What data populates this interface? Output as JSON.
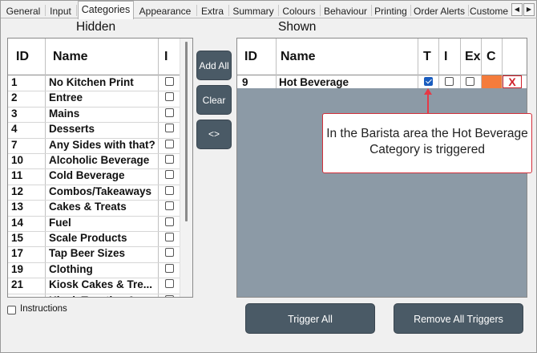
{
  "tabs": [
    "General",
    "Input",
    "Categories",
    "Appearance",
    "Extra",
    "Summary",
    "Colours",
    "Behaviour",
    "Printing",
    "Order Alerts",
    "Custome"
  ],
  "active_tab": "Categories",
  "tab_arrows": {
    "left": "◀",
    "right": "▶"
  },
  "hidden": {
    "title": "Hidden",
    "columns": {
      "id": "ID",
      "name": "Name",
      "i": "I"
    },
    "rows": [
      {
        "id": "1",
        "name": "No Kitchen Print"
      },
      {
        "id": "2",
        "name": "Entree"
      },
      {
        "id": "3",
        "name": "Mains"
      },
      {
        "id": "4",
        "name": "Desserts"
      },
      {
        "id": "7",
        "name": "Any Sides with that?"
      },
      {
        "id": "10",
        "name": "Alcoholic Beverage"
      },
      {
        "id": "11",
        "name": "Cold Beverage"
      },
      {
        "id": "12",
        "name": "Combos/Takeaways"
      },
      {
        "id": "13",
        "name": "Cakes & Treats"
      },
      {
        "id": "14",
        "name": "Fuel"
      },
      {
        "id": "15",
        "name": "Scale Products"
      },
      {
        "id": "17",
        "name": "Tap Beer Sizes"
      },
      {
        "id": "19",
        "name": "Clothing"
      },
      {
        "id": "21",
        "name": "Kiosk Cakes & Tre..."
      },
      {
        "id": "",
        "name": "Kiosk Toasties &..."
      }
    ]
  },
  "buttons": {
    "add_all": "Add All",
    "clear": "Clear",
    "swap": "<>",
    "trigger_all": "Trigger All",
    "remove_all_triggers": "Remove All Triggers"
  },
  "shown": {
    "title": "Shown",
    "columns": {
      "id": "ID",
      "name": "Name",
      "t": "T",
      "i": "I",
      "ex": "Ex",
      "c": "C"
    },
    "rows": [
      {
        "id": "9",
        "name": "Hot Beverage",
        "t": true,
        "i": false,
        "ex": false,
        "color": "#f47c3c",
        "remove": "X"
      }
    ]
  },
  "instructions_label": "Instructions",
  "callout": "In the Barista area the Hot Beverage Category is triggered",
  "colors": {
    "button_bg": "#4a5a66",
    "grid_empty": "#8c9aa6",
    "callout_border": "#d32f3a",
    "category_color": "#f47c3c",
    "remove_x": "#d0202a"
  }
}
